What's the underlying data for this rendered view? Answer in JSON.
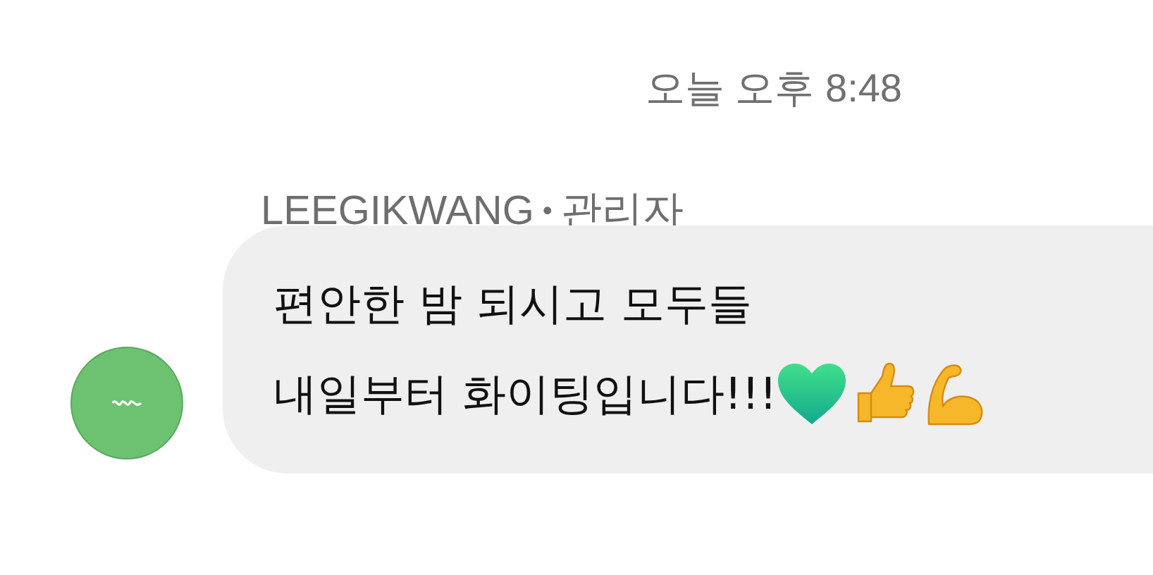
{
  "timestamp": "오늘 오후 8:48",
  "message": {
    "sender": "LEEGIKWANG",
    "role": "관리자",
    "separator": "•",
    "lines": [
      "편안한 밤 되시고 모두들",
      "내일부터 화이팅입니다!!!"
    ]
  }
}
